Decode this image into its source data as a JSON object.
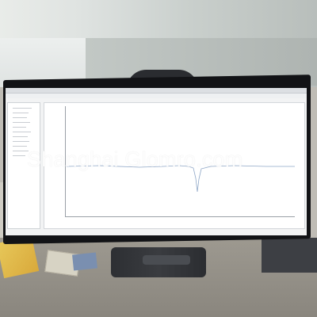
{
  "watermark": {
    "text": "Shanghai Glomro.com"
  },
  "colors": {
    "screen": "#f2f3f4",
    "bezel": "#121316",
    "taskbar": "#1f2329",
    "trace": "#8fa7c7"
  },
  "icons": {
    "window": "window-icon",
    "folder": "folder-icon",
    "chart": "chart-icon"
  }
}
